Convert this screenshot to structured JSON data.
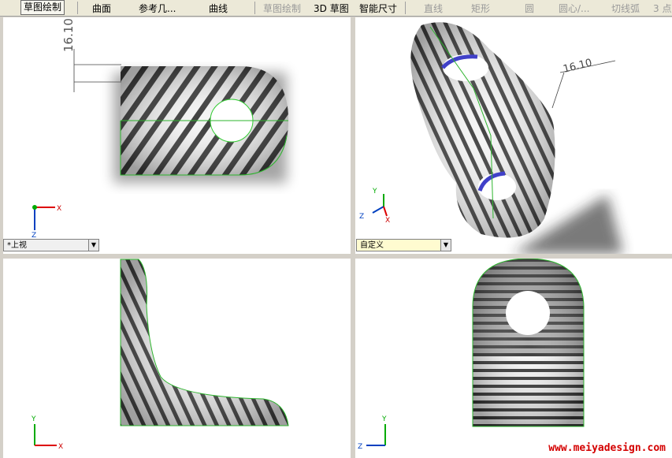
{
  "toolbar": {
    "sketch": "草图绘制",
    "surface": "曲面",
    "reference": "参考几...",
    "curve": "曲线",
    "sketch_drawing": "草图绘制",
    "sketch_3d": "3D 草图",
    "smart_dim": "智能尺寸",
    "line": "直线",
    "rect": "矩形",
    "circle": "圆",
    "center_arc": "圆心/...",
    "tangent_arc": "切线弧",
    "three_point": "3 点"
  },
  "views": {
    "top": {
      "label": "*上视",
      "dimension": "16.10"
    },
    "custom": {
      "label": "自定义",
      "dimension": "16.10"
    }
  },
  "axes": {
    "x": "X",
    "y": "Y",
    "z": "Z"
  },
  "watermark": "www.meiyadesign.com"
}
